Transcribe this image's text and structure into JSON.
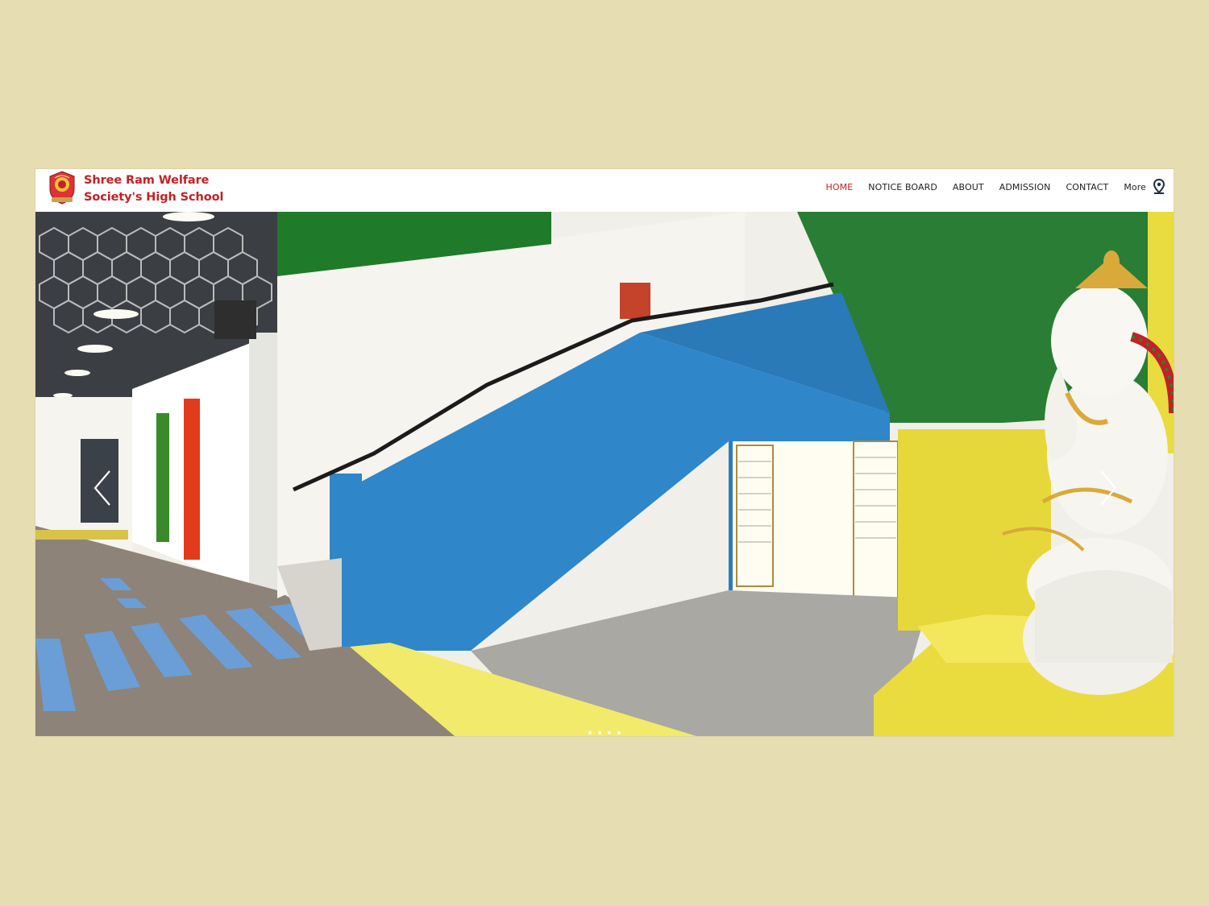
{
  "brand": {
    "line1": "Shree Ram Welfare",
    "line2": "Society's High School"
  },
  "nav": {
    "items": [
      {
        "label": "HOME",
        "active": true
      },
      {
        "label": "NOTICE BOARD",
        "active": false
      },
      {
        "label": "ABOUT",
        "active": false
      },
      {
        "label": "ADMISSION",
        "active": false
      },
      {
        "label": "CONTACT",
        "active": false
      }
    ],
    "more_label": "More",
    "location_icon": "map-pin-icon"
  },
  "slider": {
    "prev_icon": "chevron-left-icon",
    "next_icon": "chevron-right-icon",
    "slide_count": 4,
    "active_slide": 1
  },
  "colors": {
    "page_background": "#e6ddb2",
    "brand_red": "#c42026",
    "nav_text": "#222222"
  }
}
